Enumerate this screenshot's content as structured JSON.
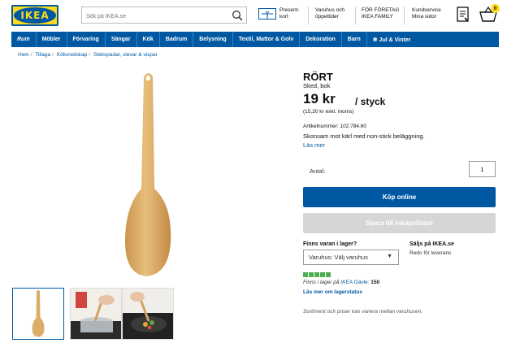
{
  "header": {
    "logo_text": "IKEA",
    "search_placeholder": "Sök på IKEA.se",
    "gift_label_1": "Present-",
    "gift_label_2": "kort",
    "stores_label_1": "Varuhus och",
    "stores_label_2": "öppettider",
    "business_label_1": "FÖR FÖRETAG",
    "business_label_2": "IKEA FAMILY",
    "service_label_1": "Kundservice",
    "service_label_2": "Mina sidor",
    "cart_count": "0"
  },
  "nav": {
    "items": [
      "Rum",
      "Möbler",
      "Förvaring",
      "Sängar",
      "Kök",
      "Badrum",
      "Belysning",
      "Textil, Mattor & Golv",
      "Dekoration",
      "Barn",
      "❄ Jul & Vinter"
    ]
  },
  "breadcrumb": [
    "Hem",
    "Tillaga",
    "Köksredskap",
    "Stekspadar, slevar & vispar"
  ],
  "product": {
    "name": "RÖRT",
    "type": "Sked, bok",
    "price": "19 kr",
    "unit": "/ styck",
    "price_excl": "(15,20 kr exkl. moms)",
    "article": "Artikelnummer: 102.784.60",
    "description": "Skonsam mot kärl med non-stick beläggning.",
    "read_more": "Läs mer"
  },
  "purchase": {
    "qty_label": "Antal:",
    "qty_value": "1",
    "buy_label": "Köp online",
    "save_label": "Spara till inköpslistan"
  },
  "stock": {
    "question": "Finns varan i lager?",
    "select_value": "Varuhus: Välj varuhus",
    "sold_heading": "Säljs på IKEA.se",
    "sold_sub": "Redo för leverans",
    "line_prefix": "Finns i lager på",
    "store_name": "IKEA Gävle",
    "line_sep": ":",
    "count": "150",
    "more": "Läs mer om lagerstatus"
  },
  "footnote": "Sortiment och priser kan variera mellan varuhusen.",
  "colors": {
    "ikea_blue": "#0058a3",
    "ikea_yellow": "#ffda1a",
    "stock_green": "#4caf50"
  }
}
